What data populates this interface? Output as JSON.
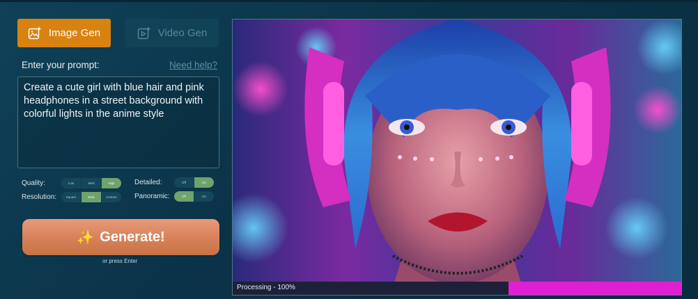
{
  "tabs": {
    "image_label": "Image Gen",
    "video_label": "Video Gen"
  },
  "prompt": {
    "label": "Enter your prompt:",
    "help_link": "Need help?",
    "value": "Create a cute girl with blue hair and pink headphones in a street background with colorful lights in the anime style"
  },
  "options": {
    "quality": {
      "label": "Quality:",
      "choices": [
        "Low",
        "Med",
        "High"
      ],
      "selected": "High"
    },
    "resolution": {
      "label": "Resolution:",
      "choices": [
        "Square",
        "Wide",
        "Custom"
      ],
      "selected": "Wide"
    },
    "detailed": {
      "label": "Detailed:",
      "choices": [
        "Off",
        "On"
      ],
      "selected": "On"
    },
    "panoramic": {
      "label": "Panoramic:",
      "choices": [
        "Off",
        "On"
      ],
      "selected": "Off"
    }
  },
  "generate": {
    "label": "Generate!",
    "hint": "or press Enter"
  },
  "preview": {
    "status": "Processing - 100%",
    "progress_percent": 100
  },
  "colors": {
    "accent": "#d9820f",
    "toggle_active": "#6fa36b",
    "progress": "#e01fd2"
  }
}
